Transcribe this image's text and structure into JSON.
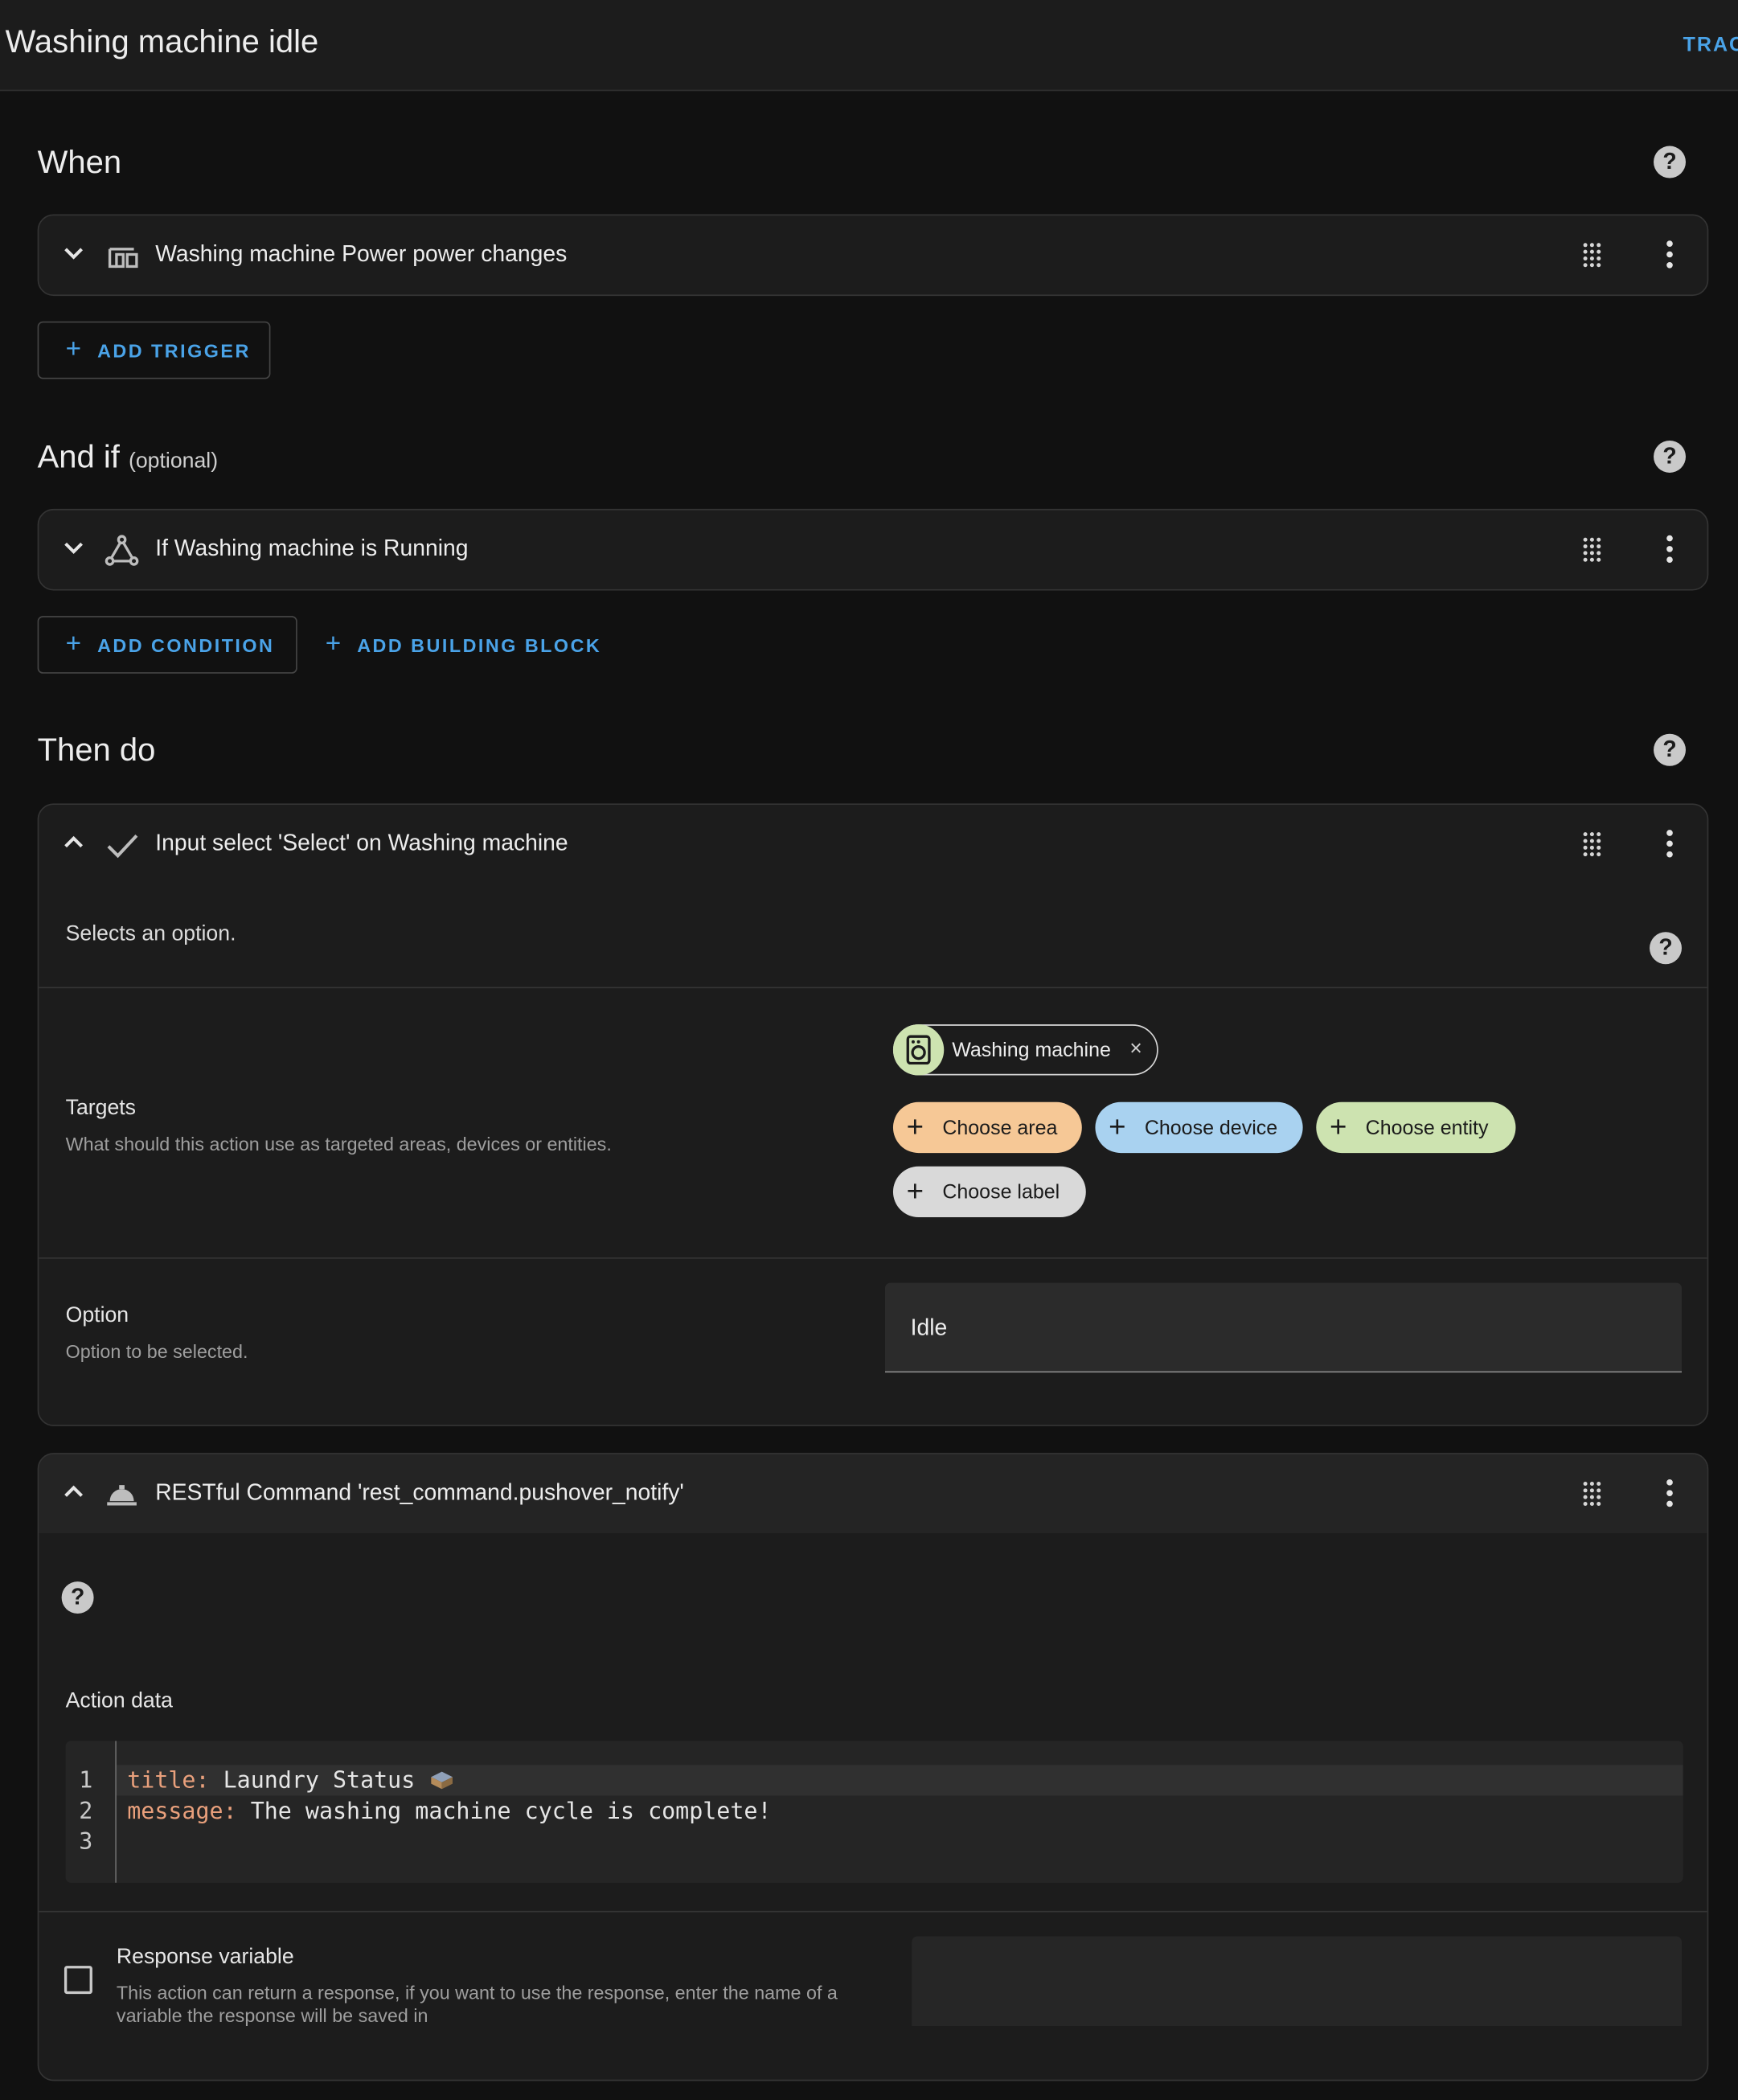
{
  "header": {
    "title": "Washing machine idle",
    "trace_label": "TRAC"
  },
  "when": {
    "heading": "When",
    "trigger_title": "Washing machine Power power changes",
    "add_trigger_label": "ADD TRIGGER"
  },
  "and_if": {
    "heading": "And if",
    "optional": "(optional)",
    "condition_title": "If Washing machine is Running",
    "add_condition_label": "ADD CONDITION",
    "add_building_block_label": "ADD BUILDING BLOCK"
  },
  "then_do": {
    "heading": "Then do",
    "action1": {
      "title": "Input select 'Select' on Washing machine",
      "description": "Selects an option.",
      "targets_label": "Targets",
      "targets_sub": "What should this action use as targeted areas, devices or entities.",
      "selected_target": "Washing machine",
      "choose_area": "Choose area",
      "choose_device": "Choose device",
      "choose_entity": "Choose entity",
      "choose_label": "Choose label",
      "option_label": "Option",
      "option_sub": "Option to be selected.",
      "option_value": "Idle"
    },
    "action2": {
      "title": "RESTful Command 'rest_command.pushover_notify'",
      "action_data_label": "Action data",
      "code": {
        "line_numbers": [
          "1",
          "2",
          "3"
        ],
        "line1_key": "title",
        "line1_value": " Laundry Status",
        "line2_key": "message",
        "line2_value": " The washing machine cycle is complete!",
        "separator": ":"
      },
      "response_label": "Response variable",
      "response_sub1": "This action can return a response, if you want to use the response, enter the name of a",
      "response_sub2": "variable the response will be saved in"
    }
  },
  "help_glyph": "?",
  "plus_glyph": "+",
  "close_glyph": "×",
  "icons": [
    "chevron-down-icon",
    "chevron-up-icon",
    "device-trigger-icon",
    "condition-icon",
    "check-icon",
    "bell-service-icon",
    "drag-handle-icon",
    "more-vert-icon",
    "help-icon",
    "washing-machine-icon",
    "close-icon",
    "plus-icon",
    "laundry-emoji-icon"
  ],
  "colors": {
    "accent": "#4aa3e8",
    "chip_area": "#f6c896",
    "chip_device": "#a9d2f0",
    "chip_entity": "#cde3b0",
    "chip_label": "#d9d9d9",
    "yaml_key": "#e9a07c"
  }
}
